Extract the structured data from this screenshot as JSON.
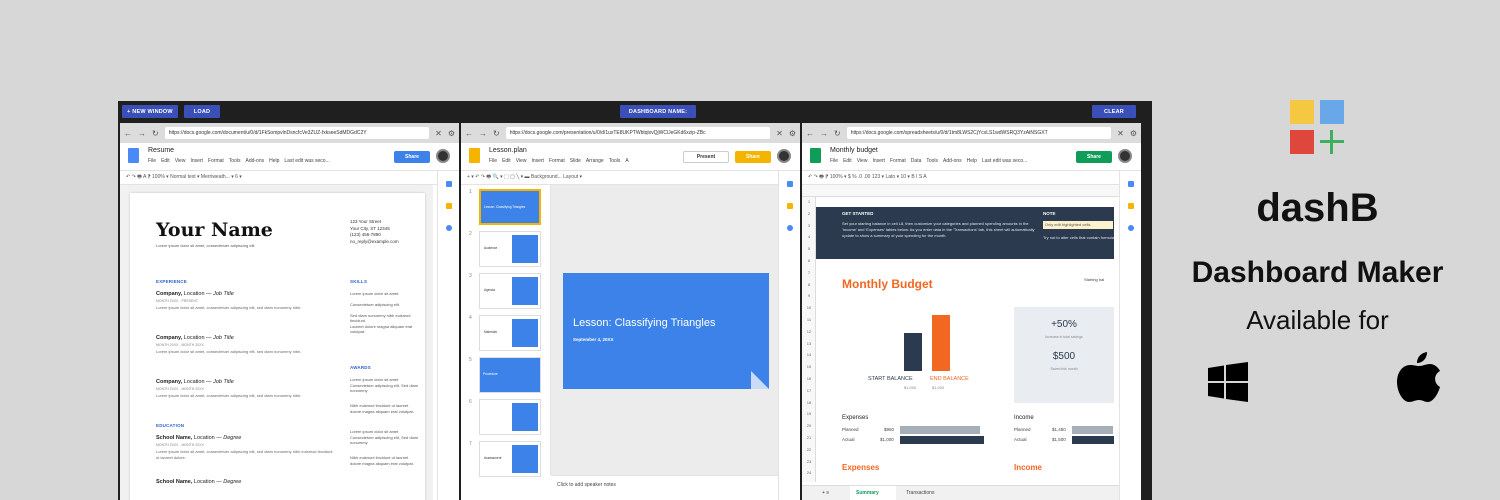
{
  "topbar": {
    "new_window_label": "+ NEW WINDOW",
    "load_label": "LOAD",
    "dashboard_name_label": "DASHBOARD NAME:",
    "clear_label": "CLEAR"
  },
  "panes": [
    {
      "url": "https://docs.google.com/document/u/0/d/1FkSompvlnDsncfcVe3ZUZ-fxkseeSdMDGdC2Y",
      "title": "Resume",
      "menus": [
        "File",
        "Edit",
        "View",
        "Insert",
        "Format",
        "Tools",
        "Add-ons",
        "Help",
        "Last edit was seco..."
      ],
      "share_label": "Share",
      "toolbar": "↶ ↷ 🖶 A  ⁋   100% ▾   Normal text ▾   Merriweath... ▾   6 ▾"
    },
    {
      "url": "https://docs.google.com/presentation/u/0/d/1uxTE8UKPTWbtqlxvQjWClJeGKd6xzip-ZBc",
      "title": "Lesson.plan",
      "menus": [
        "File",
        "Edit",
        "View",
        "Insert",
        "Format",
        "Slide",
        "Arrange",
        "Tools",
        "A"
      ],
      "present_label": "Present",
      "share_label": "Share",
      "toolbar": "+ ▾ ↶ ↷ 🖶   🔍 ▾  ⬚  ▢  ╲ ▾   ▬   Background...   Layout ▾"
    },
    {
      "url": "https://docs.google.com/spreadsheets/u/0/d/1tm8LWS2CjYcxLS1wdWSRQ3YzAtNSGXT",
      "title": "Monthly budget",
      "menus": [
        "File",
        "Edit",
        "View",
        "Insert",
        "Format",
        "Data",
        "Tools",
        "Add-ons",
        "Help",
        "Last edit was seco..."
      ],
      "share_label": "Share",
      "toolbar": "↶ ↷ 🖶 ⁋   100% ▾   $  %  .0  .00  123 ▾   Lato ▾   10 ▾   B  I  S  A"
    }
  ],
  "resume": {
    "name": "Your Name",
    "tagline": "Lorem ipsum dolor sit amet, consectetuer adipiscing elit",
    "address": [
      "123 Your Street",
      "Your City, ST 12345",
      "(123) 456-7890",
      "no_reply@example.com"
    ],
    "experience_heading": "EXPERIENCE",
    "jobs": [
      {
        "company": "Company, ",
        "location": "Location — ",
        "title": "Job Title",
        "dates": "MONTH 20XX - PRESENT",
        "desc": "Lorem ipsum dolor sit amet, consectetuer adipiscing elit, sed diam nonummy nibh."
      },
      {
        "company": "Company, ",
        "location": "Location — ",
        "title": "Job Title",
        "dates": "MONTH 20XX - MONTH 20XX",
        "desc": "Lorem ipsum dolor sit amet, consectetuer adipiscing elit, sed diam nonummy nibh."
      },
      {
        "company": "Company, ",
        "location": "Location — ",
        "title": "Job Title",
        "dates": "MONTH 20XX - MONTH 20XX",
        "desc": "Lorem ipsum dolor sit amet, consectetuer adipiscing elit, sed diam nonummy nibh."
      }
    ],
    "education_heading": "EDUCATION",
    "schools": [
      {
        "school": "School Name, ",
        "location": "Location — ",
        "degree": "Degree",
        "dates": "MONTH 20XX - MONTH 20XX",
        "desc": "Lorem ipsum dolor sit amet, consectetuer adipiscing elit, sed diam nonummy nibh euismod tincidunt ut laoreet dolore."
      },
      {
        "school": "School Name, ",
        "location": "Location — ",
        "degree": "Degree",
        "dates": "",
        "desc": ""
      }
    ],
    "skills_heading": "SKILLS",
    "skills": [
      "Lorem ipsum dolor sit amet.",
      "Consectetuer adipiscing elit.",
      "Sed diam nonummy nibh euismod tincidunt.",
      "Laoreet dolore magna aliquam erat volutpat."
    ],
    "awards_heading": "AWARDS",
    "awards": [
      "Lorem ipsum dolor sit amet Consectetuer adipiscing elit, Sed diam nonummy",
      "Nibh euismod tincidunt ut laoreet dolore magna aliquam erat volutpat.",
      "Lorem ipsum dolor sit amet Consectetuer adipiscing elit, Sed diam nonummy",
      "Nibh euismod tincidunt ut laoreet dolore magna aliquam erat volutpat."
    ]
  },
  "slides": {
    "thumbs": [
      "Lesson: Classifying Triangles",
      "Audience",
      "Agenda",
      "Materials",
      "Procedure",
      "",
      "Assessment"
    ],
    "main_title": "Lesson: Classifying Triangles",
    "main_date": "September 4, 20XX",
    "speaker_notes": "Click to add speaker notes"
  },
  "sheet": {
    "get_started_heading": "GET STARTED",
    "get_started_text": "Set your starting balance in cell L8, then customize your categories and planned spending amounts in the 'Income' and 'Expenses' tables below. As you enter data in the 'Transactions' tab, this sheet will automatically update to show a summary of your spending for the month.",
    "note_heading": "NOTE",
    "note_highlight": "Only edit highlighted cells.",
    "note_text": "Try not to alter cells that contain formulas.",
    "title": "Monthly Budget",
    "starting_balance_label": "Starting bal",
    "start_balance_label": "START BALANCE",
    "start_balance_value": "$1,000",
    "end_balance_label": "END BALANCE",
    "end_balance_value": "$1,000",
    "increase_pct": "+50%",
    "increase_label": "Increase in total savings",
    "saved_value": "$500",
    "saved_label": "Saved this month",
    "expenses_label": "Expenses",
    "income_label": "Income",
    "planned_label": "Planned",
    "actual_label": "Actual",
    "exp_planned": "$950",
    "exp_actual": "$1,000",
    "inc_planned": "$1,450",
    "inc_actual": "$1,500",
    "expenses_section": "Expenses",
    "income_section": "Income",
    "tab_summary": "Summary",
    "tab_transactions": "Transactions",
    "row_numbers": [
      "1",
      "2",
      "3",
      "4",
      "5",
      "6",
      "7",
      "8",
      "9",
      "10",
      "11",
      "12",
      "13",
      "14",
      "15",
      "16",
      "17",
      "18",
      "19",
      "20",
      "21",
      "22",
      "23",
      "24"
    ]
  },
  "brand": {
    "name": "dashB",
    "subtitle": "Dashboard Maker",
    "available": "Available for",
    "logo_colors": [
      "#f5c842",
      "#6aa7e8",
      "#e0473c",
      "#3fae5e"
    ]
  },
  "colors": {
    "topbar_button": "#3b4fb8",
    "docs_blue": "#4a8af4",
    "slides_yellow": "#f4b400",
    "sheets_green": "#0f9d58",
    "budget_orange": "#f26722",
    "budget_navy": "#2b3a4e"
  }
}
